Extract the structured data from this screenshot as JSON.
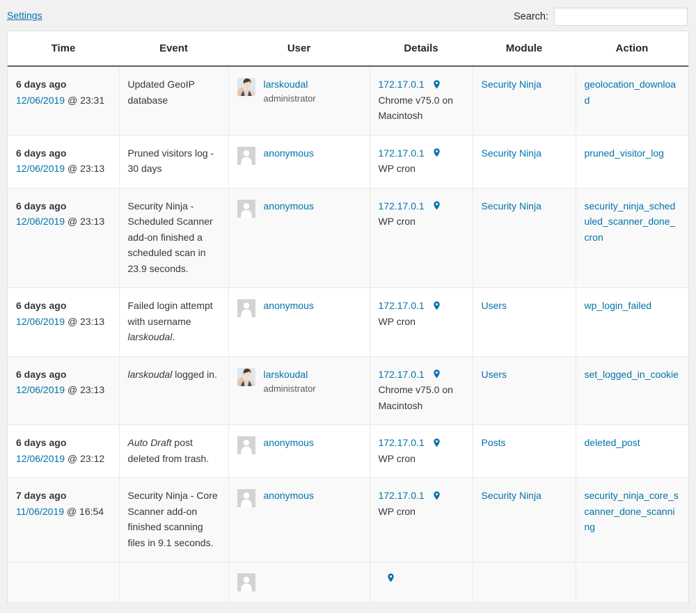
{
  "header": {
    "settings_link": "Settings",
    "search_label": "Search:",
    "search_value": "",
    "search_placeholder": ""
  },
  "colors": {
    "link": "#0073aa",
    "text": "#32373c",
    "header_rule": "#555d66",
    "page_background": "#f1f1f1",
    "row_alt": "#f9f9f9",
    "pin": "#0073aa"
  },
  "table": {
    "columns": [
      {
        "key": "time",
        "label": "Time"
      },
      {
        "key": "event",
        "label": "Event"
      },
      {
        "key": "user",
        "label": "User"
      },
      {
        "key": "details",
        "label": "Details"
      },
      {
        "key": "module",
        "label": "Module"
      },
      {
        "key": "action",
        "label": "Action"
      }
    ],
    "rows": [
      {
        "time": {
          "relative": "6 days ago",
          "date": "12/06/2019",
          "at": "@",
          "clock": "23:31"
        },
        "event": {
          "text": "Updated GeoIP database",
          "italic_prefix": "",
          "italic_suffix": ""
        },
        "user": {
          "name": "larskoudal",
          "role": "administrator",
          "avatar": "photo-avatar"
        },
        "details": {
          "ip": "172.17.0.1",
          "pin_icon": "map-pin-icon",
          "agent": "Chrome v75.0 on Macintosh"
        },
        "module": "Security Ninja",
        "action": "geolocation_download"
      },
      {
        "time": {
          "relative": "6 days ago",
          "date": "12/06/2019",
          "at": "@",
          "clock": "23:13"
        },
        "event": {
          "text": "Pruned visitors log - 30 days",
          "italic_prefix": "",
          "italic_suffix": ""
        },
        "user": {
          "name": "anonymous",
          "role": "",
          "avatar": "anonymous-avatar"
        },
        "details": {
          "ip": "172.17.0.1",
          "pin_icon": "map-pin-icon",
          "agent": "WP cron"
        },
        "module": "Security Ninja",
        "action": "pruned_visitor_log"
      },
      {
        "time": {
          "relative": "6 days ago",
          "date": "12/06/2019",
          "at": "@",
          "clock": "23:13"
        },
        "event": {
          "text": "Security Ninja - Scheduled Scanner add-on finished a scheduled scan in 23.9 seconds.",
          "italic_prefix": "",
          "italic_suffix": ""
        },
        "user": {
          "name": "anonymous",
          "role": "",
          "avatar": "anonymous-avatar"
        },
        "details": {
          "ip": "172.17.0.1",
          "pin_icon": "map-pin-icon",
          "agent": "WP cron"
        },
        "module": "Security Ninja",
        "action": "security_ninja_scheduled_scanner_done_cron"
      },
      {
        "time": {
          "relative": "6 days ago",
          "date": "12/06/2019",
          "at": "@",
          "clock": "23:13"
        },
        "event": {
          "text": "Failed login attempt with username ",
          "italic_prefix": "",
          "italic_suffix": "larskoudal",
          "tail": "."
        },
        "user": {
          "name": "anonymous",
          "role": "",
          "avatar": "anonymous-avatar"
        },
        "details": {
          "ip": "172.17.0.1",
          "pin_icon": "map-pin-icon",
          "agent": "WP cron"
        },
        "module": "Users",
        "action": "wp_login_failed"
      },
      {
        "time": {
          "relative": "6 days ago",
          "date": "12/06/2019",
          "at": "@",
          "clock": "23:13"
        },
        "event": {
          "text": " logged in.",
          "italic_prefix": "larskoudal",
          "italic_suffix": ""
        },
        "user": {
          "name": "larskoudal",
          "role": "administrator",
          "avatar": "photo-avatar"
        },
        "details": {
          "ip": "172.17.0.1",
          "pin_icon": "map-pin-icon",
          "agent": "Chrome v75.0 on Macintosh"
        },
        "module": "Users",
        "action": "set_logged_in_cookie"
      },
      {
        "time": {
          "relative": "6 days ago",
          "date": "12/06/2019",
          "at": "@",
          "clock": "23:12"
        },
        "event": {
          "text": " post deleted from trash.",
          "italic_prefix": "Auto Draft",
          "italic_suffix": ""
        },
        "user": {
          "name": "anonymous",
          "role": "",
          "avatar": "anonymous-avatar"
        },
        "details": {
          "ip": "172.17.0.1",
          "pin_icon": "map-pin-icon",
          "agent": "WP cron"
        },
        "module": "Posts",
        "action": "deleted_post"
      },
      {
        "time": {
          "relative": "7 days ago",
          "date": "11/06/2019",
          "at": "@",
          "clock": "16:54"
        },
        "event": {
          "text": "Security Ninja - Core Scanner add-on finished scanning files in 9.1 seconds.",
          "italic_prefix": "",
          "italic_suffix": ""
        },
        "user": {
          "name": "anonymous",
          "role": "",
          "avatar": "anonymous-avatar"
        },
        "details": {
          "ip": "172.17.0.1",
          "pin_icon": "map-pin-icon",
          "agent": "WP cron"
        },
        "module": "Security Ninja",
        "action": "security_ninja_core_scanner_done_scanning"
      }
    ]
  }
}
